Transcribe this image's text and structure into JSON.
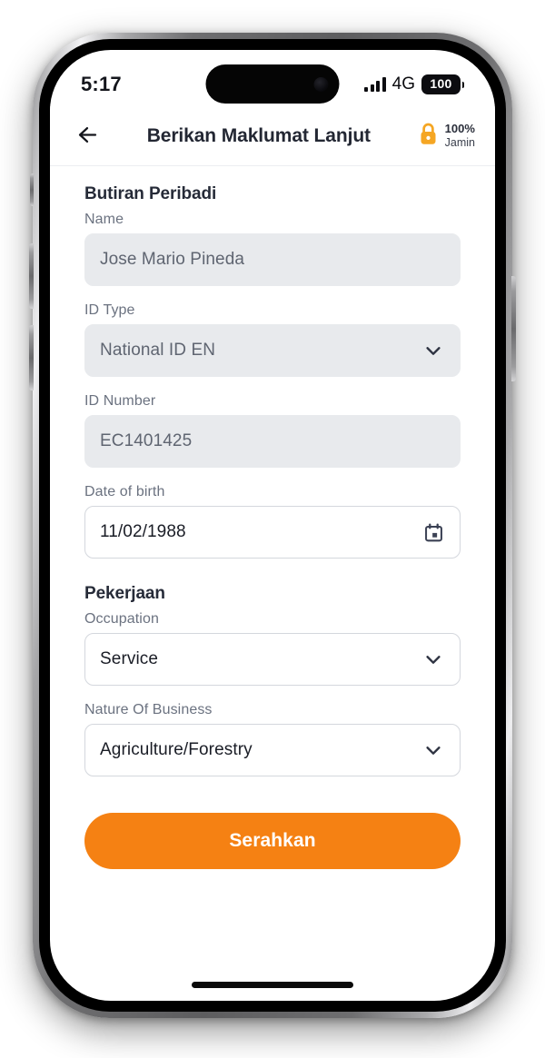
{
  "status_bar": {
    "time": "5:17",
    "network_type": "4G",
    "battery_level": "100",
    "signal_icon": "signal-bars-icon",
    "battery_icon": "battery-full-icon"
  },
  "header": {
    "back_icon": "arrow-left-icon",
    "title": "Berikan Maklumat Lanjut",
    "secure_badge": {
      "lock_icon": "lock-closed-icon",
      "percent": "100%",
      "label": "Jamin",
      "lock_color": "#f5a623"
    }
  },
  "personal_section": {
    "title": "Butiran Peribadi",
    "fields": [
      {
        "label": "Name",
        "value": "Jose Mario Pineda",
        "state": "disabled",
        "icon": null
      },
      {
        "label": "ID Type",
        "value": "National ID EN",
        "state": "disabled",
        "icon": "chevron-down-icon"
      },
      {
        "label": "ID Number",
        "value": "EC1401425",
        "state": "disabled",
        "icon": null
      },
      {
        "label": "Date of birth",
        "value": "11/02/1988",
        "state": "editable",
        "icon": "calendar-icon"
      }
    ]
  },
  "employment_section": {
    "title": "Pekerjaan",
    "fields": [
      {
        "label": "Occupation",
        "value": "Service",
        "state": "editable",
        "icon": "chevron-down-icon"
      },
      {
        "label": "Nature Of Business",
        "value": "Agriculture/Forestry",
        "state": "editable",
        "icon": "chevron-down-icon"
      }
    ]
  },
  "submit": {
    "label": "Serahkan",
    "color": "#f58113"
  },
  "colors": {
    "accent_orange": "#f58113",
    "lock_amber": "#f5a623",
    "disabled_field_bg": "#e8eaed",
    "heading_text": "#262b38",
    "label_text": "#6b7280"
  }
}
